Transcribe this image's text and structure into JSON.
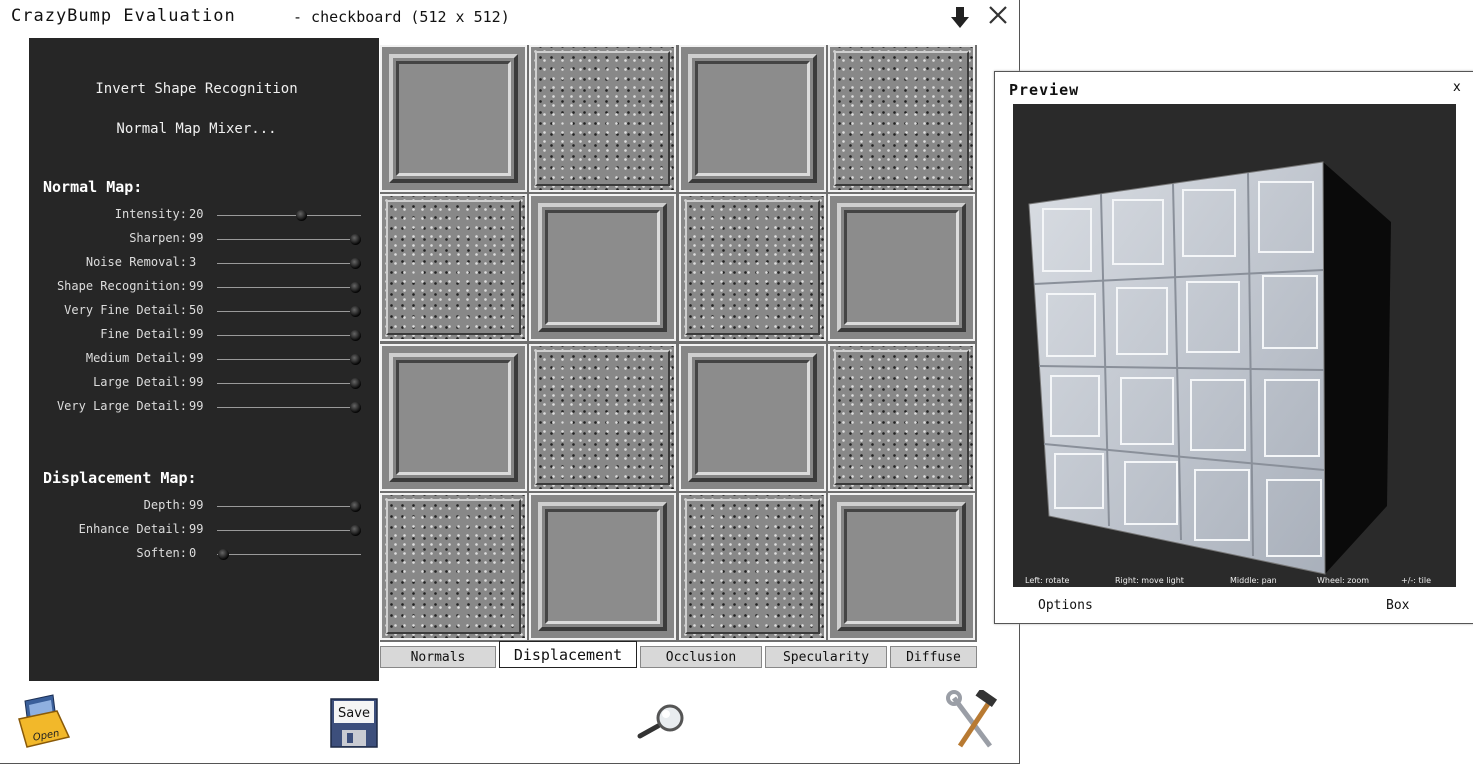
{
  "window": {
    "app_title": "CrazyBump Evaluation",
    "file_title": "- checkboard (512 x 512)"
  },
  "left_panel": {
    "invert_button": "Invert Shape Recognition",
    "mixer_button": "Normal Map Mixer...",
    "normal_map_title": "Normal Map:",
    "normal_sliders": [
      {
        "label": "Intensity:",
        "value": "20",
        "fraction": 0.58
      },
      {
        "label": "Sharpen:",
        "value": "99",
        "fraction": 0.96
      },
      {
        "label": "Noise Removal:",
        "value": "3",
        "fraction": 0.96
      },
      {
        "label": "Shape Recognition:",
        "value": "99",
        "fraction": 0.96
      },
      {
        "label": "Very Fine Detail:",
        "value": "50",
        "fraction": 0.96
      },
      {
        "label": "Fine Detail:",
        "value": "99",
        "fraction": 0.96
      },
      {
        "label": "Medium Detail:",
        "value": "99",
        "fraction": 0.96
      },
      {
        "label": "Large Detail:",
        "value": "99",
        "fraction": 0.96
      },
      {
        "label": "Very Large Detail:",
        "value": "99",
        "fraction": 0.96
      }
    ],
    "displacement_title": "Displacement Map:",
    "displacement_sliders": [
      {
        "label": "Depth:",
        "value": "99",
        "fraction": 0.96
      },
      {
        "label": "Enhance Detail:",
        "value": "99",
        "fraction": 0.96
      },
      {
        "label": "Soften:",
        "value": "0",
        "fraction": 0.04
      }
    ]
  },
  "tabs": [
    {
      "label": "Normals",
      "active": false
    },
    {
      "label": "Displacement",
      "active": true
    },
    {
      "label": "Occlusion",
      "active": false
    },
    {
      "label": "Specularity",
      "active": false
    },
    {
      "label": "Diffuse",
      "active": false
    }
  ],
  "toolbar": {
    "open_label": "Open",
    "save_label": "Save",
    "icons": [
      "open-folder-icon",
      "save-disk-icon",
      "magnifier-icon",
      "tools-icon"
    ]
  },
  "preview": {
    "title": "Preview",
    "close_label": "x",
    "hints": [
      "Left: rotate",
      "Right: move light",
      "Middle: pan",
      "Wheel: zoom",
      "+/-: tile"
    ],
    "options_label": "Options",
    "shape_label": "Box"
  }
}
